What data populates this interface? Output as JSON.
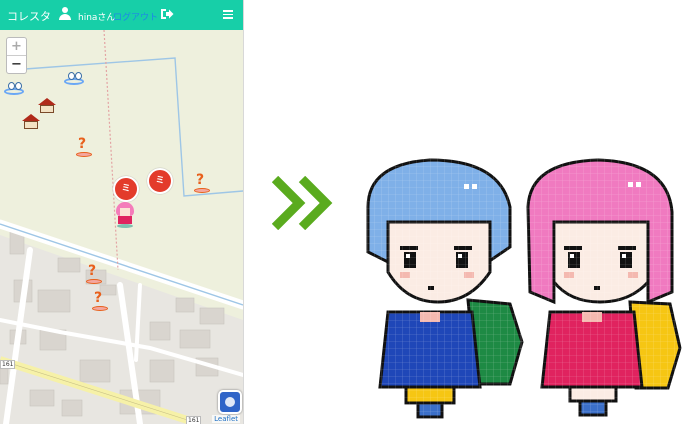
{
  "header": {
    "brand": "コレスタ",
    "username": "hinaさん",
    "logout_label": "ログアウト",
    "accent_color": "#17cfa8"
  },
  "map": {
    "zoom_in": "+",
    "zoom_out": "−",
    "attribution": "Leaflet",
    "route_labels": [
      "161",
      "161"
    ],
    "red_marker_label": "ミ",
    "question_marks": [
      "?",
      "?",
      "?",
      "?"
    ]
  },
  "icons": [
    "user-icon",
    "logout-icon",
    "menu-icon",
    "question-marker-icon",
    "house-icon",
    "avatar-icon",
    "chevrons-icon"
  ]
}
